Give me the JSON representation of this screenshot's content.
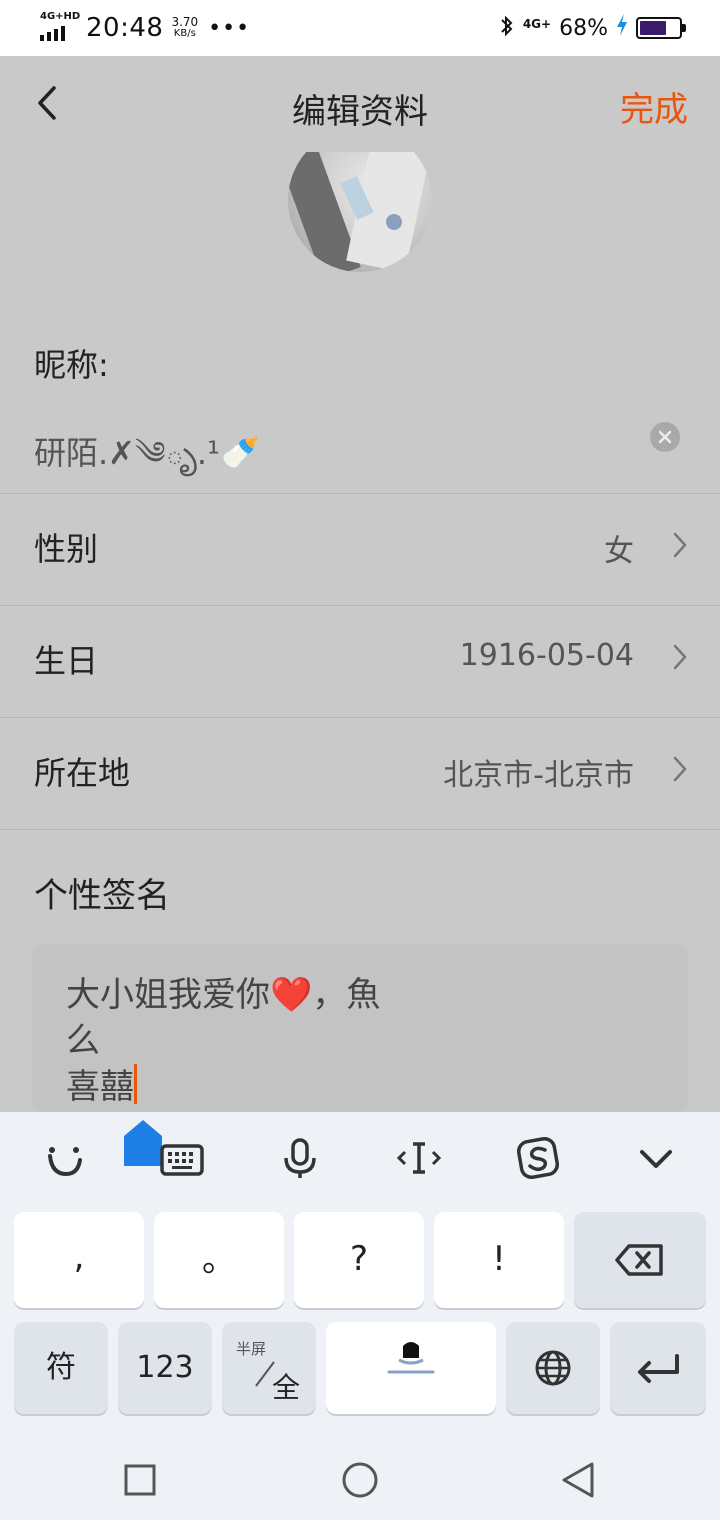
{
  "status_bar": {
    "network_label": "4G+HD",
    "time": "20:48",
    "speed_value": "3.70",
    "speed_unit": "KB/s",
    "more": "•••",
    "net_right": "4G+",
    "battery_percent": "68%",
    "battery_level": 0.68
  },
  "header": {
    "title": "编辑资料",
    "done_label": "完成",
    "accent_color": "#e8560f"
  },
  "profile": {
    "nickname_label": "昵称:",
    "nickname_value": "研陌.✗༄ృ.¹🍼",
    "gender_label": "性别",
    "gender_value": "女",
    "birthday_label": "生日",
    "birthday_value": "1916-05-04",
    "location_label": "所在地",
    "location_value": "北京市-北京市",
    "signature_title": "个性签名",
    "signature_text": "大小姐我爱你❤️，魚\n么\n喜囍"
  },
  "keyboard": {
    "toolbar": [
      "emoji-icon",
      "keyboard-icon",
      "mic-icon",
      "cursor-icon",
      "sogou-icon",
      "collapse-icon"
    ],
    "row1": [
      ",",
      "。",
      "?",
      "!"
    ],
    "fu": "符",
    "num": "123",
    "half_label": "半屏",
    "full_label": "全"
  }
}
